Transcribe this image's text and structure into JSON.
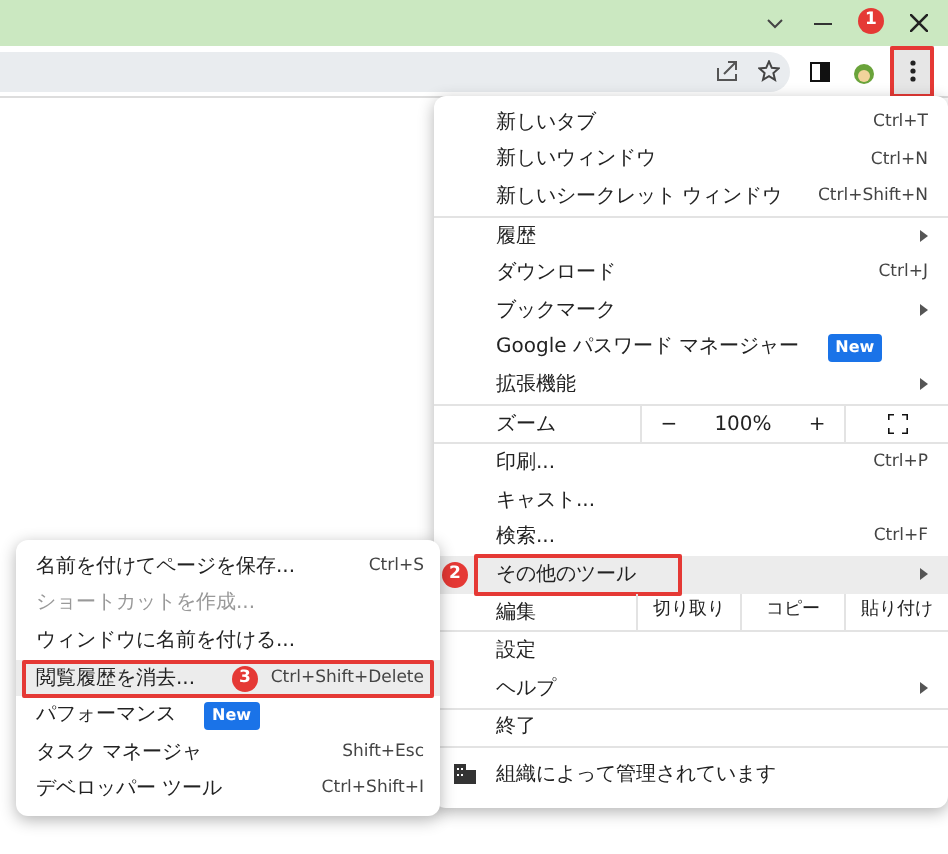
{
  "toolbar": {
    "menu_button": {
      "callout": "1"
    }
  },
  "menu": {
    "sections": [
      [
        {
          "kind": "item",
          "label": "新しいタブ",
          "shortcut": "Ctrl+T",
          "selected": false
        },
        {
          "kind": "item",
          "label": "新しいウィンドウ",
          "shortcut": "Ctrl+N",
          "selected": false
        },
        {
          "kind": "item",
          "label": "新しいシークレット ウィンドウ",
          "shortcut": "Ctrl+Shift+N",
          "selected": false
        }
      ],
      [
        {
          "kind": "item",
          "label": "履歴",
          "submenu": true,
          "selected": false
        },
        {
          "kind": "item",
          "label": "ダウンロード",
          "shortcut": "Ctrl+J",
          "selected": false
        },
        {
          "kind": "item",
          "label": "ブックマーク",
          "submenu": true,
          "selected": false
        },
        {
          "kind": "item",
          "label": "Google パスワード マネージャー",
          "badge": "New",
          "selected": false
        },
        {
          "kind": "item",
          "label": "拡張機能",
          "submenu": true,
          "selected": false
        }
      ],
      [
        {
          "kind": "zoom",
          "label": "ズーム",
          "minus": "−",
          "value": "100%",
          "plus": "+",
          "selected": false
        }
      ],
      [
        {
          "kind": "item",
          "label": "印刷...",
          "shortcut": "Ctrl+P",
          "selected": false
        },
        {
          "kind": "item",
          "label": "キャスト...",
          "selected": false
        },
        {
          "kind": "item",
          "label": "検索...",
          "shortcut": "Ctrl+F",
          "selected": false
        },
        {
          "kind": "item",
          "label": "その他のツール",
          "submenu": true,
          "selected": true,
          "callout": "2"
        }
      ],
      [
        {
          "kind": "edit",
          "label": "編集",
          "buttons": [
            "切り取り",
            "コピー",
            "貼り付け"
          ],
          "selected": false
        }
      ],
      [
        {
          "kind": "item",
          "label": "設定",
          "selected": false
        },
        {
          "kind": "item",
          "label": "ヘルプ",
          "submenu": true,
          "selected": false
        }
      ],
      [
        {
          "kind": "item",
          "label": "終了",
          "selected": false
        }
      ],
      [
        {
          "kind": "managed",
          "label": "組織によって管理されています",
          "selected": false
        }
      ]
    ]
  },
  "submenu": {
    "sections": [
      [
        {
          "label": "名前を付けてページを保存...",
          "shortcut": "Ctrl+S",
          "selected": false,
          "disabled": false
        },
        {
          "label": "ショートカットを作成...",
          "selected": false,
          "disabled": true
        },
        {
          "label": "ウィンドウに名前を付ける...",
          "selected": false,
          "disabled": false
        },
        {
          "label": "閲覧履歴を消去...",
          "shortcut": "Ctrl+Shift+Delete",
          "selected": true,
          "disabled": false,
          "callout": "3"
        },
        {
          "label": "パフォーマンス",
          "badge": "New",
          "selected": false,
          "disabled": false
        },
        {
          "label": "タスク マネージャ",
          "shortcut": "Shift+Esc",
          "selected": false,
          "disabled": false
        }
      ],
      [
        {
          "label": "デベロッパー ツール",
          "shortcut": "Ctrl+Shift+I",
          "selected": false,
          "disabled": false
        }
      ]
    ]
  }
}
